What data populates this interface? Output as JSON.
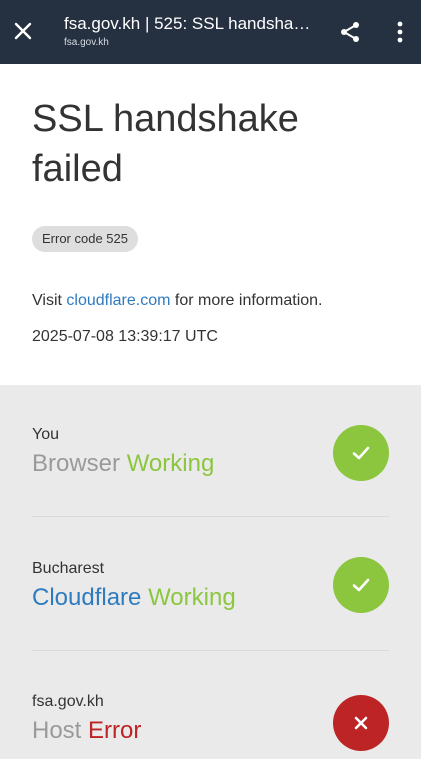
{
  "toolbar": {
    "title": "fsa.gov.kh | 525: SSL handshak...",
    "url": "fsa.gov.kh",
    "background": "#253041",
    "icons": [
      "close-icon",
      "share-icon",
      "more-vert-icon"
    ]
  },
  "error": {
    "title": "SSL handshake failed",
    "code_badge": "Error code 525",
    "visit_prefix": "Visit ",
    "visit_link": "cloudflare.com",
    "visit_suffix": " for more information.",
    "timestamp": "2025-07-08 13:39:17 UTC"
  },
  "status": [
    {
      "location": "You",
      "name": "Browser",
      "state": "Working",
      "ok": true,
      "icon": "check-icon"
    },
    {
      "location": "Bucharest",
      "name": "Cloudflare",
      "state": "Working",
      "ok": true,
      "icon": "check-icon"
    },
    {
      "location": "fsa.gov.kh",
      "name": "Host",
      "state": "Error",
      "ok": false,
      "icon": "x-icon"
    }
  ],
  "colors": {
    "ok_green": "#8cc63f",
    "error_red": "#bd2426",
    "link_blue": "#2f7bbf"
  }
}
